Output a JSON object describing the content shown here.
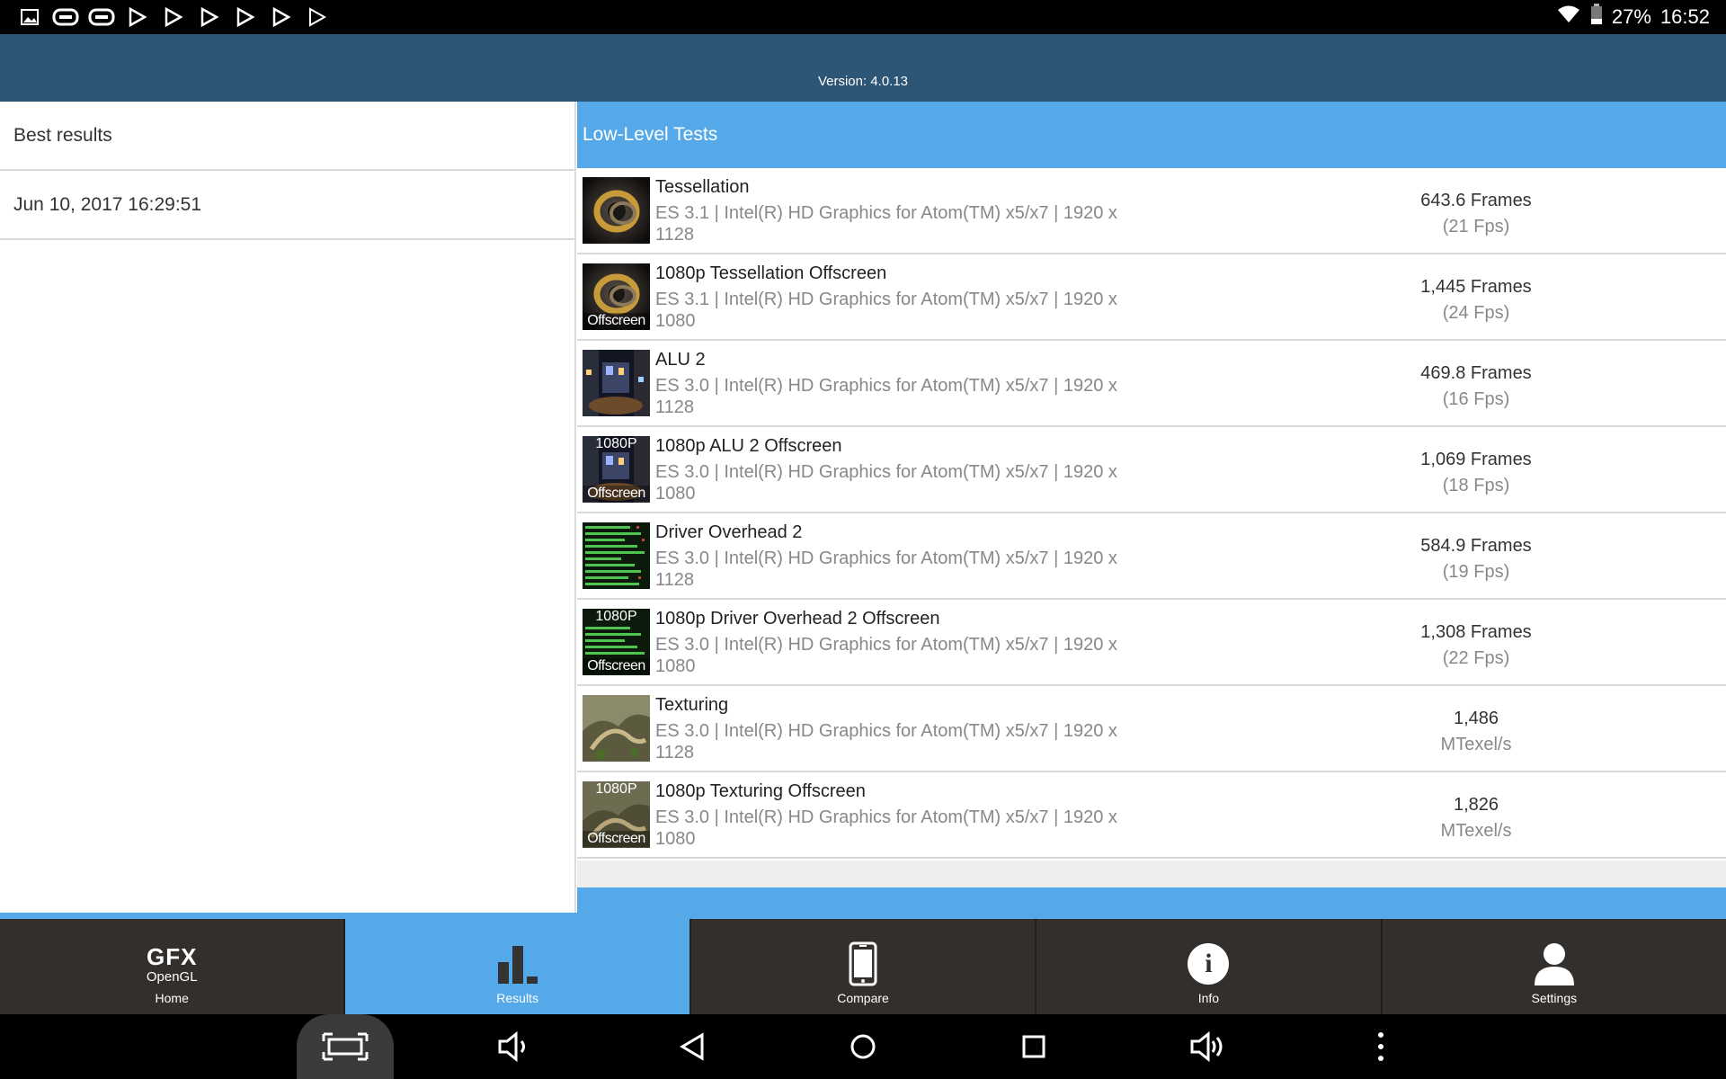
{
  "status_bar": {
    "battery": "27%",
    "time": "16:52"
  },
  "header": {
    "version": "Version: 4.0.13"
  },
  "left_panel": {
    "items": [
      {
        "label": "Best results"
      },
      {
        "label": "Jun 10, 2017 16:29:51"
      }
    ]
  },
  "right_panel": {
    "section_title": "Low-Level Tests",
    "rows": [
      {
        "title": "Tessellation",
        "desc": "ES 3.1 | Intel(R) HD Graphics for Atom(TM) x5/x7 | 1920 x 1128",
        "score": "643.6 Frames",
        "sub": "(21 Fps)",
        "thumb_top": "",
        "thumb_bottom": ""
      },
      {
        "title": "1080p Tessellation Offscreen",
        "desc": "ES 3.1 | Intel(R) HD Graphics for Atom(TM) x5/x7 | 1920 x 1080",
        "score": "1,445 Frames",
        "sub": "(24 Fps)",
        "thumb_top": "",
        "thumb_bottom": "Offscreen"
      },
      {
        "title": "ALU 2",
        "desc": "ES 3.0 | Intel(R) HD Graphics for Atom(TM) x5/x7 | 1920 x 1128",
        "score": "469.8 Frames",
        "sub": "(16 Fps)",
        "thumb_top": "",
        "thumb_bottom": ""
      },
      {
        "title": "1080p ALU 2 Offscreen",
        "desc": "ES 3.0 | Intel(R) HD Graphics for Atom(TM) x5/x7 | 1920 x 1080",
        "score": "1,069 Frames",
        "sub": "(18 Fps)",
        "thumb_top": "1080P",
        "thumb_bottom": "Offscreen"
      },
      {
        "title": "Driver Overhead 2",
        "desc": "ES 3.0 | Intel(R) HD Graphics for Atom(TM) x5/x7 | 1920 x 1128",
        "score": "584.9 Frames",
        "sub": "(19 Fps)",
        "thumb_top": "",
        "thumb_bottom": ""
      },
      {
        "title": "1080p Driver Overhead 2 Offscreen",
        "desc": "ES 3.0 | Intel(R) HD Graphics for Atom(TM) x5/x7 | 1920 x 1080",
        "score": "1,308 Frames",
        "sub": "(22 Fps)",
        "thumb_top": "1080P",
        "thumb_bottom": "Offscreen"
      },
      {
        "title": "Texturing",
        "desc": "ES 3.0 | Intel(R) HD Graphics for Atom(TM) x5/x7 | 1920 x 1128",
        "score": "1,486",
        "sub": "MTexel/s",
        "thumb_top": "",
        "thumb_bottom": ""
      },
      {
        "title": "1080p Texturing Offscreen",
        "desc": "ES 3.0 | Intel(R) HD Graphics for Atom(TM) x5/x7 | 1920 x 1080",
        "score": "1,826",
        "sub": "MTexel/s",
        "thumb_top": "1080P",
        "thumb_bottom": "Offscreen"
      }
    ]
  },
  "bottom_nav": {
    "logo_top": "GFX",
    "logo_bottom": "OpenGL",
    "items": [
      {
        "label": "Home"
      },
      {
        "label": "Results"
      },
      {
        "label": "Compare"
      },
      {
        "label": "Info"
      },
      {
        "label": "Settings"
      }
    ],
    "info_glyph": "i"
  },
  "colors": {
    "header": "#2d5575",
    "accent": "#55a9e8",
    "nav_bg": "#332f2c"
  }
}
